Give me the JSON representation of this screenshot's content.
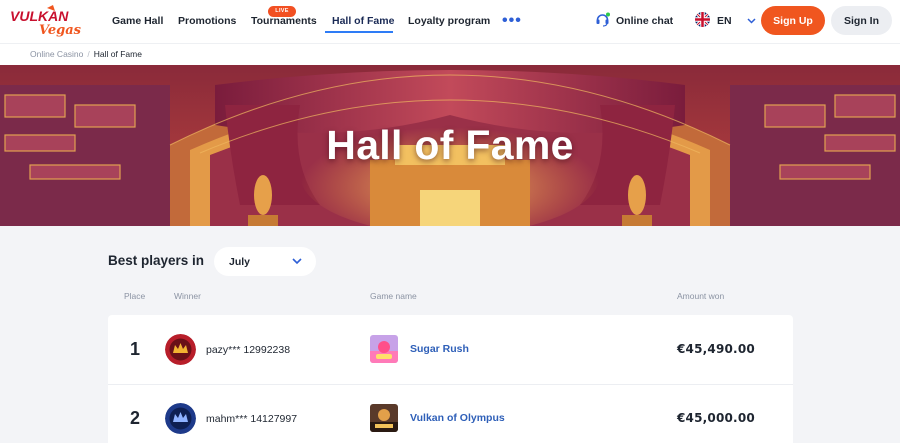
{
  "header": {
    "logo_text": "VULKAN Vegas",
    "nav": [
      {
        "label": "Game Hall"
      },
      {
        "label": "Promotions"
      },
      {
        "label": "Tournaments",
        "badge": "LIVE"
      },
      {
        "label": "Hall of Fame",
        "active": true
      },
      {
        "label": "Loyalty program"
      }
    ],
    "more_icon": "more-dots-icon",
    "chat_label": "Online chat",
    "language": "EN",
    "signup_label": "Sign Up",
    "signin_label": "Sign In"
  },
  "breadcrumb": {
    "items": [
      "Online Casino",
      "Hall of Fame"
    ],
    "separator": "/"
  },
  "banner": {
    "title": "Hall of Fame"
  },
  "filter": {
    "label": "Best players in",
    "selected_month": "July"
  },
  "table": {
    "columns": [
      "Place",
      "Winner",
      "Game name",
      "Amount won"
    ],
    "rows": [
      {
        "place": "1",
        "winner": "pazy*** 12992238",
        "game": "Sugar Rush",
        "amount": "€45,490.00"
      },
      {
        "place": "2",
        "winner": "mahm*** 14127997",
        "game": "Vulkan of Olympus",
        "amount": "€45,000.00"
      }
    ]
  },
  "colors": {
    "accent": "#f0561f",
    "link": "#2e5fb8",
    "nav_underline": "#2e7cf6",
    "live_badge": "#f25022"
  }
}
